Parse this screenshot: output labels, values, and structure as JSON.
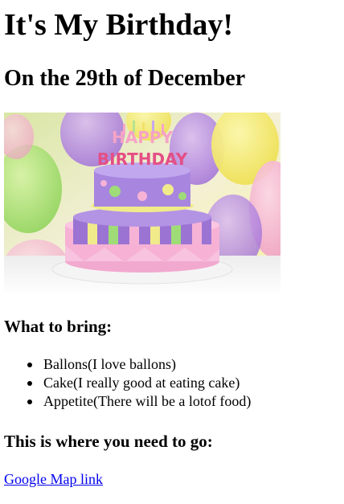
{
  "page": {
    "title": "It's My Birthday!",
    "date_heading": "On the 29th of December",
    "bring_heading": "What to bring:",
    "bring_items": [
      "Ballons(I love ballons)",
      "Cake(I really good at eating cake)",
      "Appetite(There will be a lotof food)"
    ],
    "location_heading": "This is where you need to go:",
    "map_link_text": "Google Map link"
  },
  "photo": {
    "cake_topper_line1": "HAPPY",
    "cake_topper_line2": "BIRTHDAY"
  },
  "colors": {
    "link": "#0000ee",
    "text": "#000000"
  }
}
